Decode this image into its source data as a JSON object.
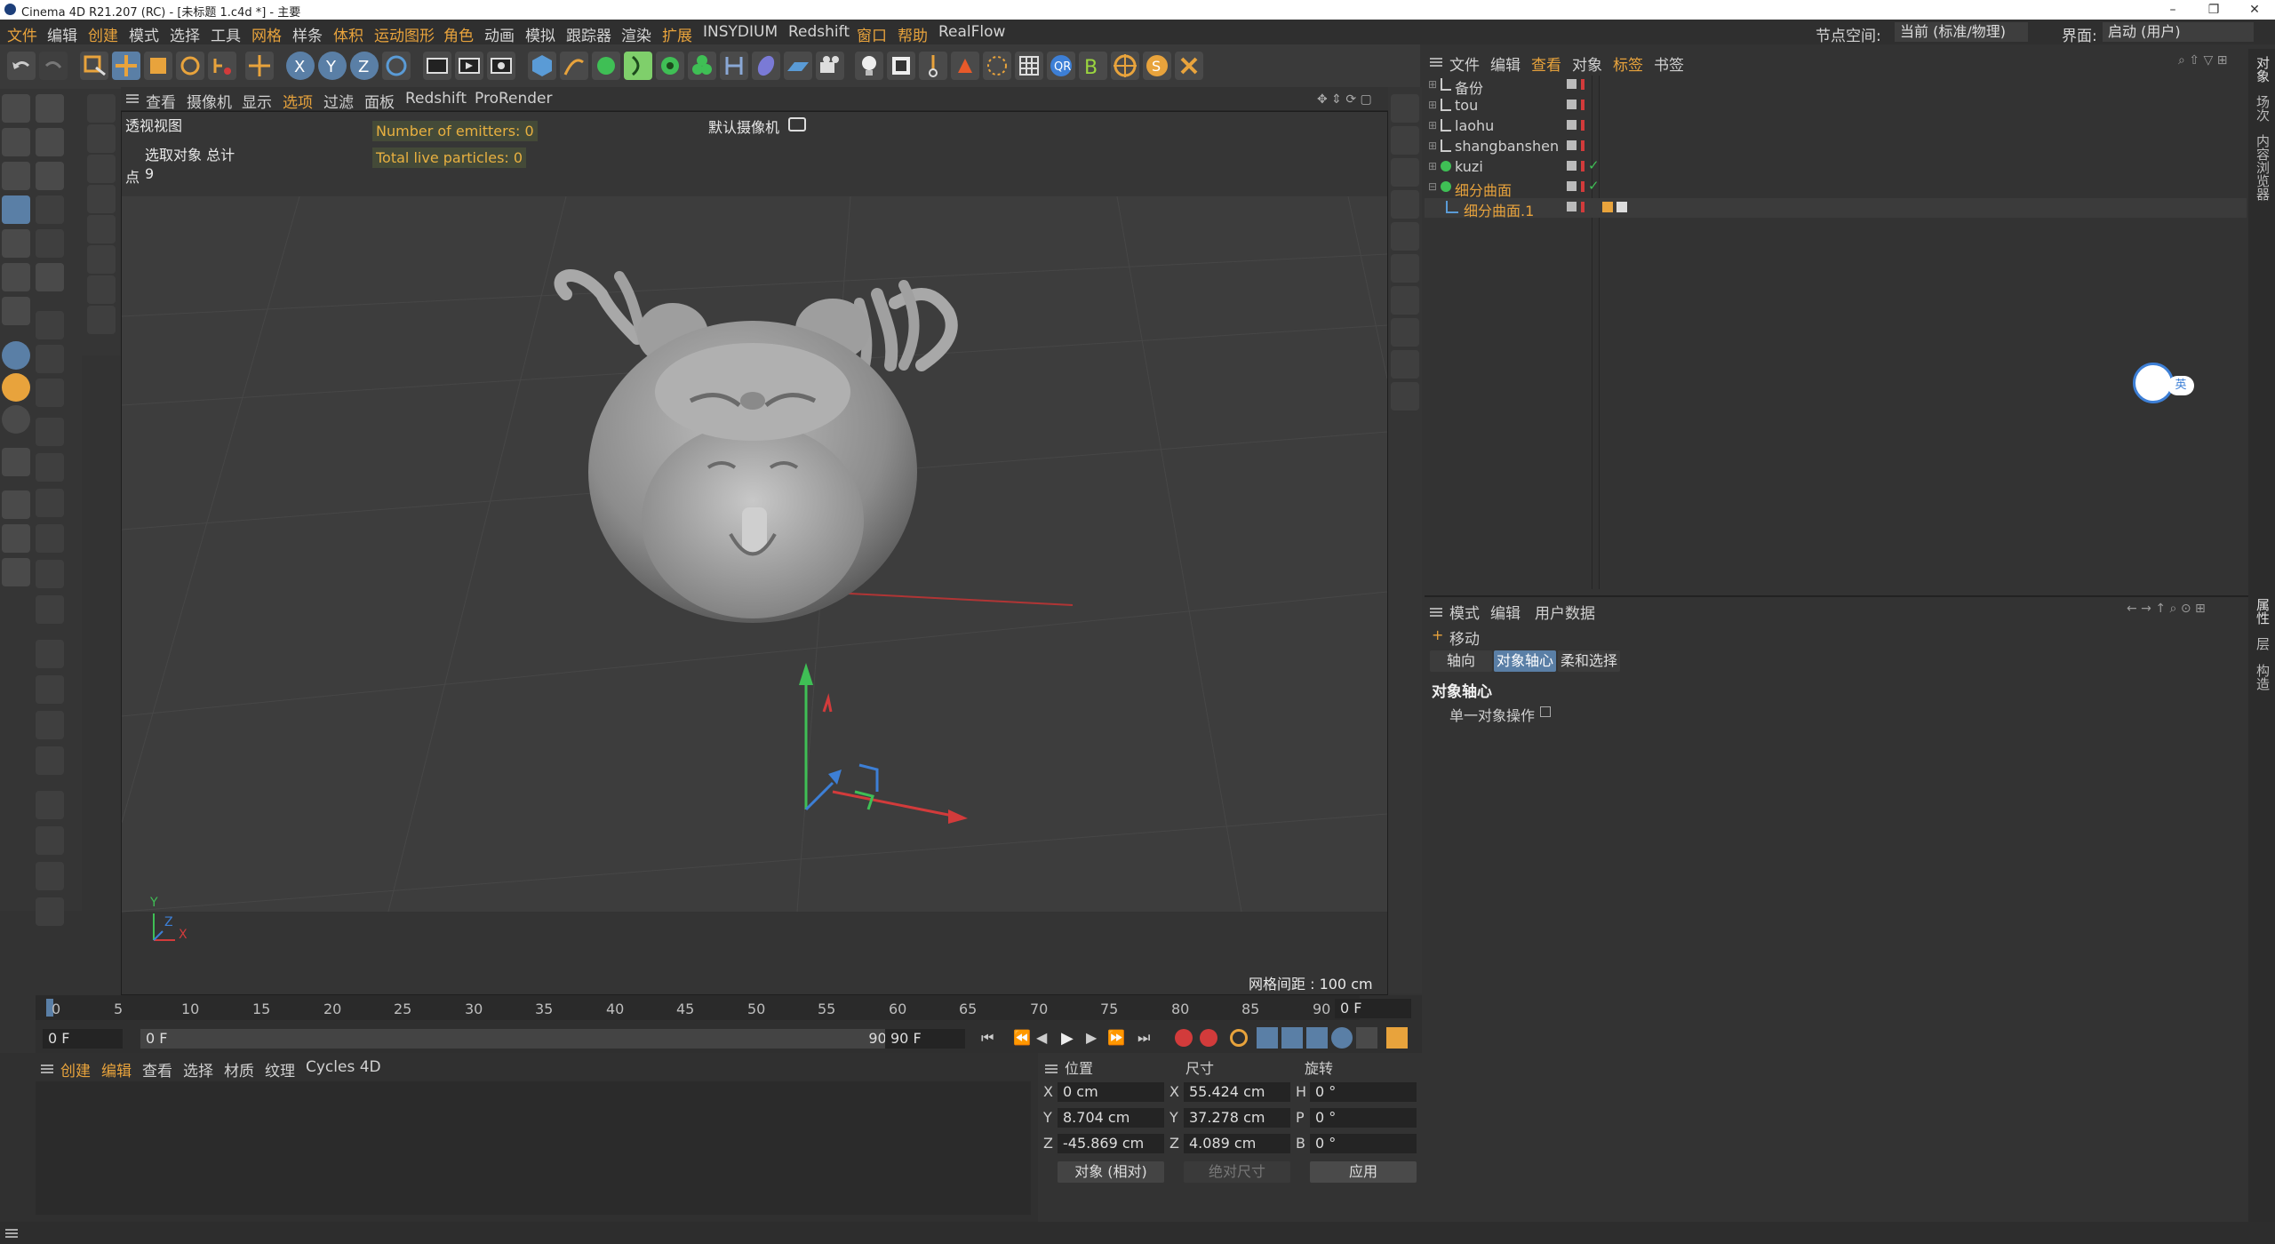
{
  "window": {
    "title": "Cinema 4D R21.207 (RC) - [未标题 1.c4d *] - 主要",
    "controls": [
      "–",
      "❐",
      "✕"
    ]
  },
  "menubar": {
    "items": [
      "文件",
      "编辑",
      "创建",
      "模式",
      "选择",
      "工具",
      "网格",
      "样条",
      "体积",
      "运动图形",
      "角色",
      "动画",
      "模拟",
      "跟踪器",
      "渲染",
      "扩展",
      "INSYDIUM",
      "Redshift",
      "窗口",
      "帮助",
      "RealFlow"
    ],
    "highlighted": [
      "文件",
      "创建",
      "网格",
      "体积",
      "运动图形",
      "角色",
      "扩展",
      "窗口",
      "帮助"
    ],
    "node_space_label": "节点空间:",
    "node_space_value": "当前 (标准/物理)",
    "layout_label": "界面:",
    "layout_value": "启动 (用户)"
  },
  "viewport": {
    "menu": [
      "查看",
      "摄像机",
      "显示",
      "选项",
      "过滤",
      "面板",
      "Redshift",
      "ProRender"
    ],
    "menu_highlight": "选项",
    "view_name": "透视视图",
    "stats_title": "选取对象 总计",
    "points_label": "点",
    "points_value": "9",
    "camera_label": "默认摄像机",
    "emitters": "Number of emitters: 0",
    "particles": "Total live particles: 0",
    "grid_spacing": "网格间距 : 100 cm",
    "axis_labels": [
      "Y",
      "Z",
      "X"
    ]
  },
  "timeline": {
    "ticks": [
      "0",
      "5",
      "10",
      "15",
      "20",
      "25",
      "30",
      "35",
      "40",
      "45",
      "50",
      "55",
      "60",
      "65",
      "70",
      "75",
      "80",
      "85",
      "90"
    ],
    "current_frame": "0 F",
    "start_field": "0 F",
    "range_start": "0 F",
    "range_end": "90 F",
    "end_field": "90 F"
  },
  "material_manager": {
    "menu": [
      "创建",
      "编辑",
      "查看",
      "选择",
      "材质",
      "纹理",
      "Cycles 4D"
    ],
    "highlighted": [
      "创建",
      "编辑"
    ]
  },
  "coordinates": {
    "headers": [
      "位置",
      "尺寸",
      "旋转"
    ],
    "rows": [
      {
        "axis": "X",
        "pos": "0 cm",
        "size_axis": "X",
        "size": "55.424 cm",
        "rot_axis": "H",
        "rot": "0 °"
      },
      {
        "axis": "Y",
        "pos": "8.704 cm",
        "size_axis": "Y",
        "size": "37.278 cm",
        "rot_axis": "P",
        "rot": "0 °"
      },
      {
        "axis": "Z",
        "pos": "-45.869 cm",
        "size_axis": "Z",
        "size": "4.089 cm",
        "rot_axis": "B",
        "rot": "0 °"
      }
    ],
    "mode_select": "对象 (相对)",
    "size_select": "绝对尺寸",
    "apply": "应用"
  },
  "object_manager": {
    "menu": [
      "文件",
      "编辑",
      "查看",
      "对象",
      "标签",
      "书签"
    ],
    "highlighted": [
      "查看",
      "标签"
    ],
    "objects": [
      {
        "name": "备份",
        "color": "#cfcfcf"
      },
      {
        "name": "tou",
        "color": "#cfcfcf"
      },
      {
        "name": "laohu",
        "color": "#cfcfcf"
      },
      {
        "name": "shangbanshen",
        "color": "#cfcfcf"
      },
      {
        "name": "kuzi",
        "color": "#cfcfcf"
      },
      {
        "name": "细分曲面",
        "color": "#e8a33c"
      },
      {
        "name": "细分曲面.1",
        "color": "#e8a33c"
      }
    ],
    "ime_badge": "英"
  },
  "attribute_manager": {
    "menu": [
      "模式",
      "编辑",
      "用户数据"
    ],
    "tool_name": "移动",
    "tabs": [
      "轴向",
      "对象轴心",
      "柔和选择"
    ],
    "active_tab": "对象轴心",
    "section_title": "对象轴心",
    "option_label": "单一对象操作"
  },
  "side_tabs": {
    "top": [
      "对象",
      "场次",
      "内容浏览器"
    ],
    "bottom": [
      "属性",
      "层",
      "构造"
    ]
  },
  "colors": {
    "accent": "#e8a33c",
    "axis_x": "#d23b3b",
    "axis_y": "#3fbf55",
    "axis_z": "#3d7fd6",
    "selection_blue": "#5a7fa6"
  }
}
